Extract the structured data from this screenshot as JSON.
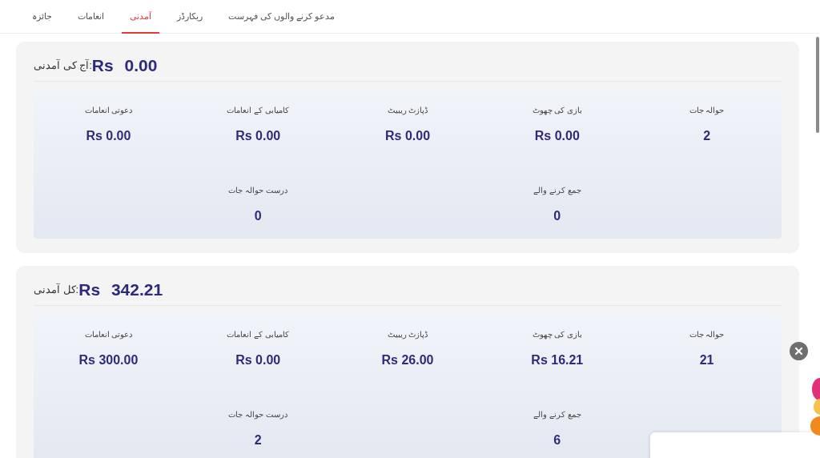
{
  "tabs": [
    {
      "label": "مدعو کرنے والوں کی فہرست",
      "selected": false
    },
    {
      "label": "ریکارڈز",
      "selected": false
    },
    {
      "label": "آمدنی",
      "selected": true
    },
    {
      "label": "انعامات",
      "selected": false
    },
    {
      "label": "جائزہ",
      "selected": false
    }
  ],
  "sections": [
    {
      "label": ":آج کی آمدنی",
      "amount": "Rs 0.00",
      "rows": [
        [
          {
            "label": "حوالہ جات",
            "value": "2"
          },
          {
            "label": "بازی کی چھوٹ",
            "value": "Rs 0.00"
          },
          {
            "label": "ڈپازٹ ریبیٹ",
            "value": "Rs 0.00"
          },
          {
            "label": "کامیابی کے انعامات",
            "value": "Rs 0.00"
          },
          {
            "label": "دعوتی انعامات",
            "value": "Rs 0.00"
          }
        ],
        [
          null,
          {
            "label": "جمع کرنے والے",
            "value": "0"
          },
          null,
          {
            "label": "درست حوالہ جات",
            "value": "0"
          },
          null
        ]
      ]
    },
    {
      "label": ":کل آمدنی",
      "amount": "Rs 342.21",
      "rows": [
        [
          {
            "label": "حوالہ جات",
            "value": "21"
          },
          {
            "label": "بازی کی چھوٹ",
            "value": "Rs 16.21"
          },
          {
            "label": "ڈپازٹ ریبیٹ",
            "value": "Rs 26.00"
          },
          {
            "label": "کامیابی کے انعامات",
            "value": "Rs 0.00"
          },
          {
            "label": "دعوتی انعامات",
            "value": "Rs 300.00"
          }
        ],
        [
          null,
          {
            "label": "جمع کرنے والے",
            "value": "6"
          },
          null,
          {
            "label": "درست حوالہ جات",
            "value": "2"
          },
          null
        ]
      ]
    }
  ]
}
